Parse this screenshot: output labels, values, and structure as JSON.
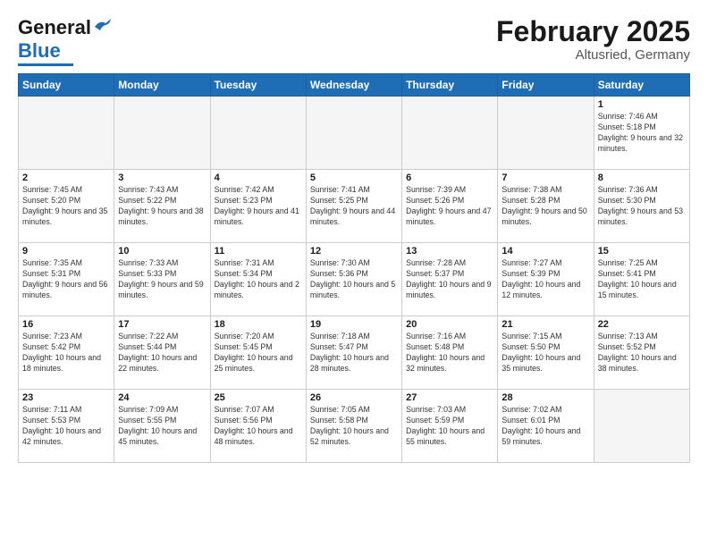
{
  "header": {
    "logo_general": "General",
    "logo_blue": "Blue",
    "main_title": "February 2025",
    "subtitle": "Altusried, Germany"
  },
  "days_of_week": [
    "Sunday",
    "Monday",
    "Tuesday",
    "Wednesday",
    "Thursday",
    "Friday",
    "Saturday"
  ],
  "weeks": [
    [
      {
        "day": "",
        "empty": true
      },
      {
        "day": "",
        "empty": true
      },
      {
        "day": "",
        "empty": true
      },
      {
        "day": "",
        "empty": true
      },
      {
        "day": "",
        "empty": true
      },
      {
        "day": "",
        "empty": true
      },
      {
        "day": "1",
        "sunrise": "Sunrise: 7:46 AM",
        "sunset": "Sunset: 5:18 PM",
        "daylight": "Daylight: 9 hours and 32 minutes."
      }
    ],
    [
      {
        "day": "2",
        "sunrise": "Sunrise: 7:45 AM",
        "sunset": "Sunset: 5:20 PM",
        "daylight": "Daylight: 9 hours and 35 minutes."
      },
      {
        "day": "3",
        "sunrise": "Sunrise: 7:43 AM",
        "sunset": "Sunset: 5:22 PM",
        "daylight": "Daylight: 9 hours and 38 minutes."
      },
      {
        "day": "4",
        "sunrise": "Sunrise: 7:42 AM",
        "sunset": "Sunset: 5:23 PM",
        "daylight": "Daylight: 9 hours and 41 minutes."
      },
      {
        "day": "5",
        "sunrise": "Sunrise: 7:41 AM",
        "sunset": "Sunset: 5:25 PM",
        "daylight": "Daylight: 9 hours and 44 minutes."
      },
      {
        "day": "6",
        "sunrise": "Sunrise: 7:39 AM",
        "sunset": "Sunset: 5:26 PM",
        "daylight": "Daylight: 9 hours and 47 minutes."
      },
      {
        "day": "7",
        "sunrise": "Sunrise: 7:38 AM",
        "sunset": "Sunset: 5:28 PM",
        "daylight": "Daylight: 9 hours and 50 minutes."
      },
      {
        "day": "8",
        "sunrise": "Sunrise: 7:36 AM",
        "sunset": "Sunset: 5:30 PM",
        "daylight": "Daylight: 9 hours and 53 minutes."
      }
    ],
    [
      {
        "day": "9",
        "sunrise": "Sunrise: 7:35 AM",
        "sunset": "Sunset: 5:31 PM",
        "daylight": "Daylight: 9 hours and 56 minutes."
      },
      {
        "day": "10",
        "sunrise": "Sunrise: 7:33 AM",
        "sunset": "Sunset: 5:33 PM",
        "daylight": "Daylight: 9 hours and 59 minutes."
      },
      {
        "day": "11",
        "sunrise": "Sunrise: 7:31 AM",
        "sunset": "Sunset: 5:34 PM",
        "daylight": "Daylight: 10 hours and 2 minutes."
      },
      {
        "day": "12",
        "sunrise": "Sunrise: 7:30 AM",
        "sunset": "Sunset: 5:36 PM",
        "daylight": "Daylight: 10 hours and 5 minutes."
      },
      {
        "day": "13",
        "sunrise": "Sunrise: 7:28 AM",
        "sunset": "Sunset: 5:37 PM",
        "daylight": "Daylight: 10 hours and 9 minutes."
      },
      {
        "day": "14",
        "sunrise": "Sunrise: 7:27 AM",
        "sunset": "Sunset: 5:39 PM",
        "daylight": "Daylight: 10 hours and 12 minutes."
      },
      {
        "day": "15",
        "sunrise": "Sunrise: 7:25 AM",
        "sunset": "Sunset: 5:41 PM",
        "daylight": "Daylight: 10 hours and 15 minutes."
      }
    ],
    [
      {
        "day": "16",
        "sunrise": "Sunrise: 7:23 AM",
        "sunset": "Sunset: 5:42 PM",
        "daylight": "Daylight: 10 hours and 18 minutes."
      },
      {
        "day": "17",
        "sunrise": "Sunrise: 7:22 AM",
        "sunset": "Sunset: 5:44 PM",
        "daylight": "Daylight: 10 hours and 22 minutes."
      },
      {
        "day": "18",
        "sunrise": "Sunrise: 7:20 AM",
        "sunset": "Sunset: 5:45 PM",
        "daylight": "Daylight: 10 hours and 25 minutes."
      },
      {
        "day": "19",
        "sunrise": "Sunrise: 7:18 AM",
        "sunset": "Sunset: 5:47 PM",
        "daylight": "Daylight: 10 hours and 28 minutes."
      },
      {
        "day": "20",
        "sunrise": "Sunrise: 7:16 AM",
        "sunset": "Sunset: 5:48 PM",
        "daylight": "Daylight: 10 hours and 32 minutes."
      },
      {
        "day": "21",
        "sunrise": "Sunrise: 7:15 AM",
        "sunset": "Sunset: 5:50 PM",
        "daylight": "Daylight: 10 hours and 35 minutes."
      },
      {
        "day": "22",
        "sunrise": "Sunrise: 7:13 AM",
        "sunset": "Sunset: 5:52 PM",
        "daylight": "Daylight: 10 hours and 38 minutes."
      }
    ],
    [
      {
        "day": "23",
        "sunrise": "Sunrise: 7:11 AM",
        "sunset": "Sunset: 5:53 PM",
        "daylight": "Daylight: 10 hours and 42 minutes."
      },
      {
        "day": "24",
        "sunrise": "Sunrise: 7:09 AM",
        "sunset": "Sunset: 5:55 PM",
        "daylight": "Daylight: 10 hours and 45 minutes."
      },
      {
        "day": "25",
        "sunrise": "Sunrise: 7:07 AM",
        "sunset": "Sunset: 5:56 PM",
        "daylight": "Daylight: 10 hours and 48 minutes."
      },
      {
        "day": "26",
        "sunrise": "Sunrise: 7:05 AM",
        "sunset": "Sunset: 5:58 PM",
        "daylight": "Daylight: 10 hours and 52 minutes."
      },
      {
        "day": "27",
        "sunrise": "Sunrise: 7:03 AM",
        "sunset": "Sunset: 5:59 PM",
        "daylight": "Daylight: 10 hours and 55 minutes."
      },
      {
        "day": "28",
        "sunrise": "Sunrise: 7:02 AM",
        "sunset": "Sunset: 6:01 PM",
        "daylight": "Daylight: 10 hours and 59 minutes."
      },
      {
        "day": "",
        "empty": true
      }
    ]
  ]
}
